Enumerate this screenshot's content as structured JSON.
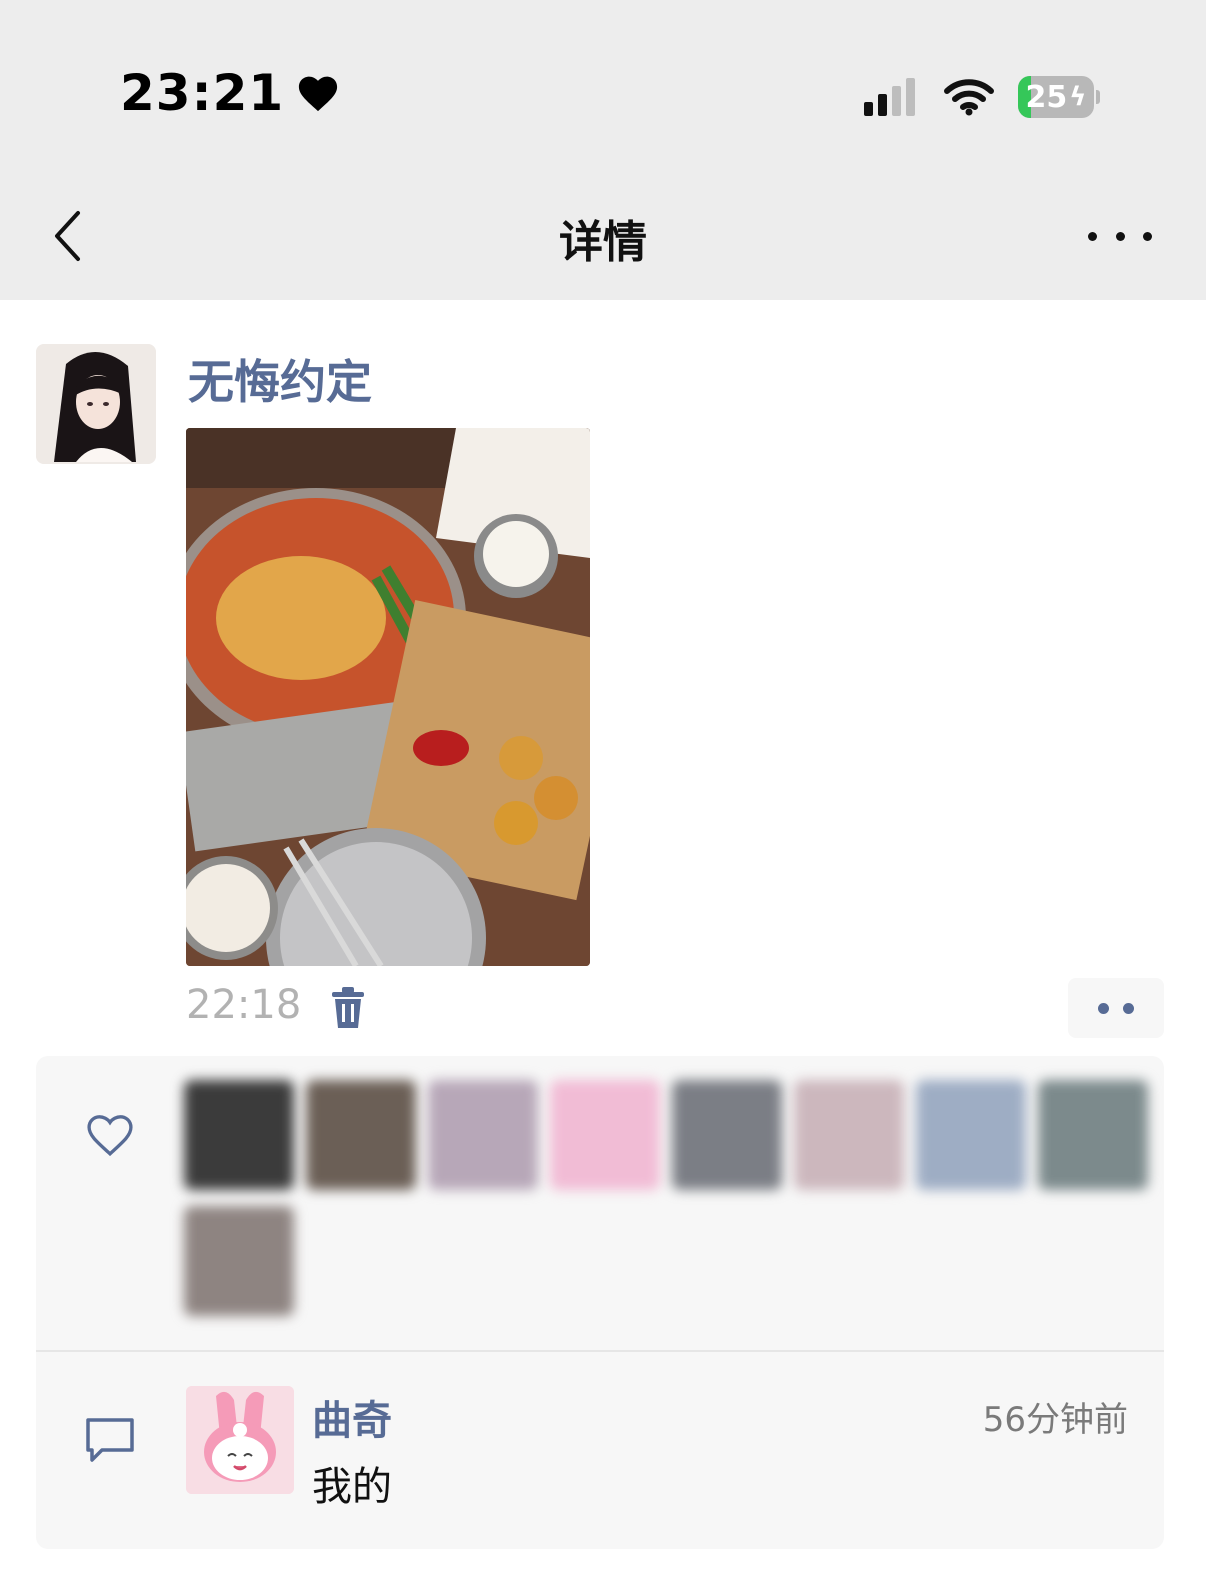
{
  "status_bar": {
    "time": "23:21",
    "battery": "25",
    "icons": [
      "heart-icon",
      "signal-icon",
      "wifi-icon",
      "battery-charging-icon"
    ]
  },
  "nav": {
    "title": "详情",
    "back_icon": "chevron-left-icon",
    "more_icon": "more-horizontal-icon"
  },
  "post": {
    "author": "无悔约定",
    "time": "22:18",
    "photo_desc_icon": "food-photo",
    "delete_icon": "trash-icon"
  },
  "likes": {
    "icon": "heart-outline-icon",
    "count": 9
  },
  "comments": [
    {
      "name": "曲奇",
      "time": "56分钟前",
      "text": "我的"
    }
  ],
  "colors": {
    "link": "#576b95",
    "topbar_bg": "#ededed",
    "panel_bg": "#f7f7f7",
    "battery_green": "#35c759"
  }
}
